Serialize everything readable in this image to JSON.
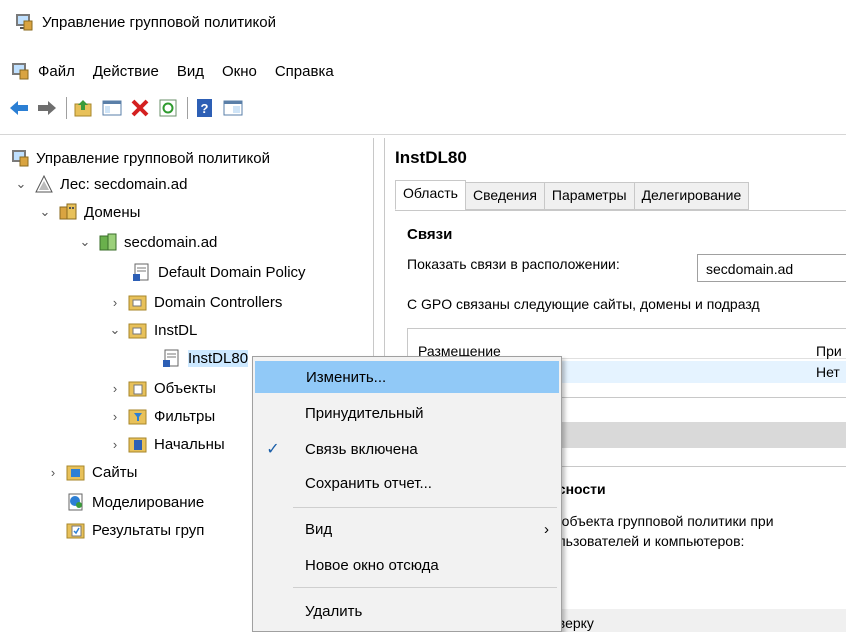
{
  "window": {
    "title": "Управление групповой политикой"
  },
  "menu": [
    "Файл",
    "Действие",
    "Вид",
    "Окно",
    "Справка"
  ],
  "toolbar": [
    "back-icon",
    "forward-icon",
    "up-folder-icon",
    "show-hide-tree-icon",
    "delete-icon",
    "refresh-icon",
    "help-icon",
    "properties-icon"
  ],
  "tree": {
    "root": "Управление групповой политикой",
    "forest": "Лес: secdomain.ad",
    "domains": "Домены",
    "domain": "secdomain.ad",
    "default_policy": "Default Domain Policy",
    "domain_controllers": "Domain Controllers",
    "instdl": "InstDL",
    "instdl80": "InstDL80",
    "objects": "Объекты",
    "filters": "Фильтры",
    "starter": "Начальны",
    "sites": "Сайты",
    "modeling": "Моделирование",
    "results": "Результаты груп"
  },
  "right": {
    "title": "InstDL80",
    "tabs": [
      "Область",
      "Сведения",
      "Параметры",
      "Делегирование"
    ],
    "links_heading": "Связи",
    "show_links_label": "Показать связи в расположении:",
    "location_value": "secdomain.ad",
    "gpo_text": "С GPO связаны следующие сайты, домены и подразд",
    "col_location": "Размещение",
    "col_enforced": "При",
    "row_enforced": "Нет",
    "security_heading": "асности",
    "security_line1": "о объекта групповой политики при",
    "security_line2": "ользователей и компьютеров:",
    "security_line3": "оверку"
  },
  "context_menu": {
    "edit": "Изменить...",
    "enforced": "Принудительный",
    "link_enabled": "Связь включена",
    "save_report": "Сохранить отчет...",
    "view": "Вид",
    "new_window": "Новое окно отсюда",
    "delete": "Удалить"
  }
}
